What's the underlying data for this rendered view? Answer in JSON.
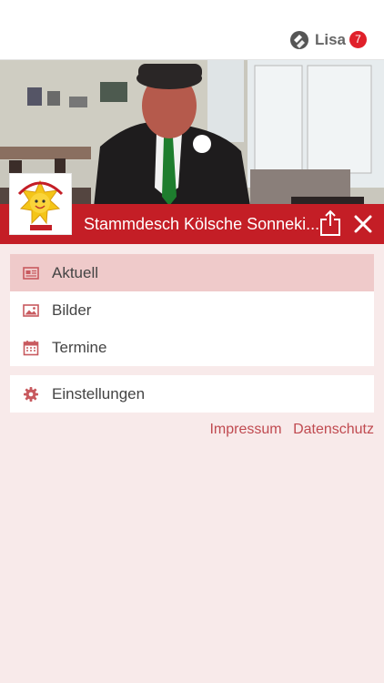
{
  "header": {
    "user_name": "Lisa",
    "notification_count": "7"
  },
  "club": {
    "title": "Stammdesch Kölsche Sonneki...",
    "logo_text": "Kölsche Sonnekinder vun 1971"
  },
  "menu": {
    "items": [
      {
        "label": "Aktuell",
        "icon": "news-icon",
        "active": true
      },
      {
        "label": "Bilder",
        "icon": "image-icon",
        "active": false
      },
      {
        "label": "Termine",
        "icon": "calendar-icon",
        "active": false
      }
    ],
    "settings_label": "Einstellungen",
    "settings_icon": "gear-icon"
  },
  "footer": {
    "impressum": "Impressum",
    "datenschutz": "Datenschutz"
  },
  "colors": {
    "brand_red": "#c41e26",
    "background": "#f8eaea",
    "active_item": "#efcaca",
    "link": "#c04a50",
    "icon": "#c85a5f"
  }
}
